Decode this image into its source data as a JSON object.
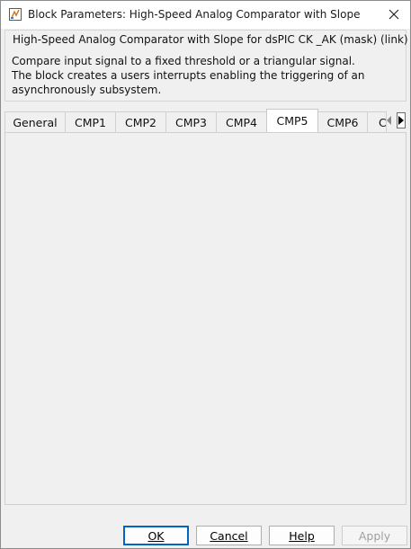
{
  "window": {
    "title": "Block Parameters: High-Speed Analog Comparator with Slope",
    "icon": "simulink-block-icon",
    "close_icon": "close-icon"
  },
  "description_group": {
    "title": "High-Speed Analog Comparator with Slope for dsPIC CK _AK (mask) (link)",
    "description": "Compare input signal to a fixed threshold or a triangular signal.\nThe block creates a users interrupts enabling the triggering of an\nasynchronously subsystem."
  },
  "tabs": {
    "items": [
      {
        "label": "General"
      },
      {
        "label": "CMP1"
      },
      {
        "label": "CMP2"
      },
      {
        "label": "CMP3"
      },
      {
        "label": "CMP4"
      },
      {
        "label": "CMP5"
      },
      {
        "label": "CMP6"
      },
      {
        "label": "C"
      }
    ],
    "active": "CMP5",
    "scroll_left_icon": "chevron-left-icon",
    "scroll_right_icon": "chevron-right-icon"
  },
  "buttons": {
    "ok": "OK",
    "cancel": "Cancel",
    "help": "Help",
    "apply": "Apply"
  },
  "colors": {
    "accent": "#0067c0",
    "disabled_text": "#a0a0a0",
    "background": "#f0f0f0"
  }
}
